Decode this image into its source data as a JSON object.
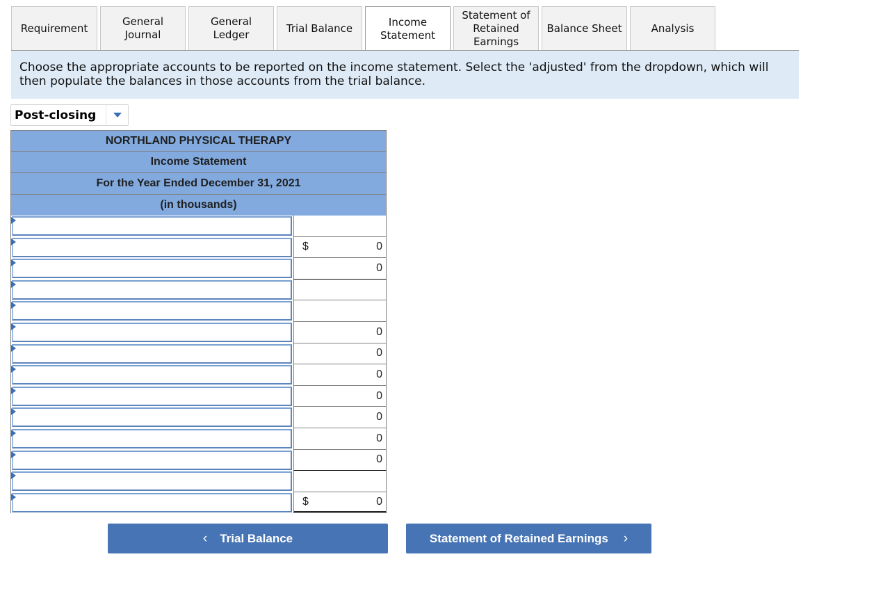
{
  "tabs": [
    {
      "label": "Requirement",
      "active": false
    },
    {
      "label": "General\nJournal",
      "active": false
    },
    {
      "label": "General\nLedger",
      "active": false
    },
    {
      "label": "Trial Balance",
      "active": false
    },
    {
      "label": "Income\nStatement",
      "active": true
    },
    {
      "label": "Statement of\nRetained\nEarnings",
      "active": false
    },
    {
      "label": "Balance Sheet",
      "active": false
    },
    {
      "label": "Analysis",
      "active": false
    }
  ],
  "instructions": "Choose the appropriate accounts to be reported on the income statement. Select the 'adjusted' from the dropdown, which will then populate the balances in those accounts from the trial balance.",
  "balance_type_dropdown": {
    "selected": "Post-closing"
  },
  "statement": {
    "company": "NORTHLAND PHYSICAL THERAPY",
    "title": "Income Statement",
    "period": "For the Year Ended December 31, 2021",
    "units": "(in thousands)",
    "rows": [
      {
        "account": "",
        "currency": "",
        "amount": ""
      },
      {
        "account": "",
        "currency": "$",
        "amount": "0"
      },
      {
        "account": "",
        "currency": "",
        "amount": "0"
      },
      {
        "account": "",
        "currency": "",
        "amount": ""
      },
      {
        "account": "",
        "currency": "",
        "amount": ""
      },
      {
        "account": "",
        "currency": "",
        "amount": "0"
      },
      {
        "account": "",
        "currency": "",
        "amount": "0"
      },
      {
        "account": "",
        "currency": "",
        "amount": "0"
      },
      {
        "account": "",
        "currency": "",
        "amount": "0"
      },
      {
        "account": "",
        "currency": "",
        "amount": "0"
      },
      {
        "account": "",
        "currency": "",
        "amount": "0"
      },
      {
        "account": "",
        "currency": "",
        "amount": "0"
      },
      {
        "account": "",
        "currency": "",
        "amount": ""
      },
      {
        "account": "",
        "currency": "$",
        "amount": "0"
      }
    ]
  },
  "nav": {
    "prev_label": "Trial Balance",
    "prev_icon": "chevron-left-icon",
    "next_label": "Statement of Retained Earnings",
    "next_icon": "chevron-right-icon"
  }
}
